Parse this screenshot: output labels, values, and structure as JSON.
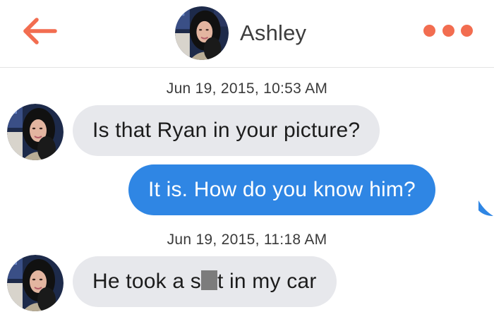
{
  "header": {
    "contact_name": "Ashley",
    "back_icon": "arrow-left-icon",
    "more_icon": "more-dots-icon",
    "accent_color": "#f26d50"
  },
  "conversation": {
    "messages": [
      {
        "timestamp": "Jun 19, 2015, 10:53 AM"
      },
      {
        "sender": "Ashley",
        "direction": "incoming",
        "text": "Is that Ryan in your picture?"
      },
      {
        "sender": "me",
        "direction": "outgoing",
        "text": "It is. How do you know him?"
      },
      {
        "timestamp": "Jun 19, 2015, 11:18 AM"
      },
      {
        "sender": "Ashley",
        "direction": "incoming",
        "text_before": "He took a s",
        "censored": true,
        "text_after": "t in my car"
      }
    ],
    "incoming_bubble_color": "#e7e8ec",
    "outgoing_bubble_color": "#2f86e4"
  }
}
